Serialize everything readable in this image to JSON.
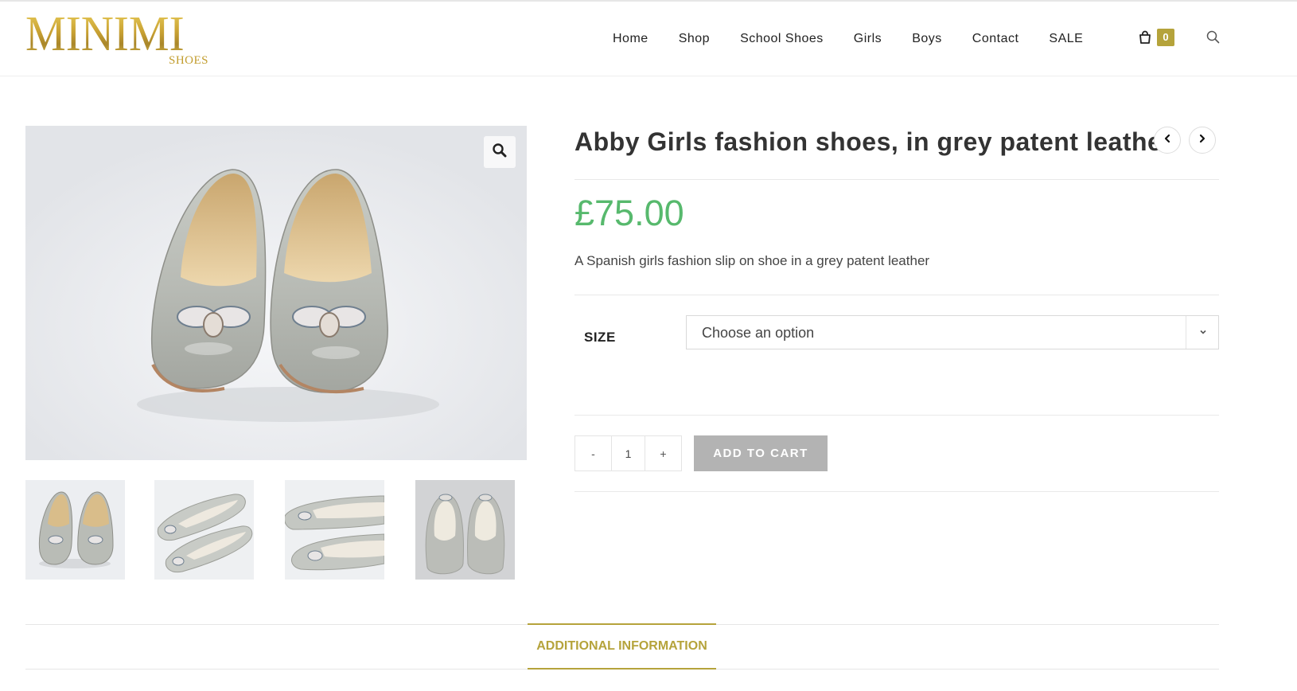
{
  "brand": {
    "logo_main": "MINIMI",
    "logo_sub": "SHOES"
  },
  "nav": {
    "items": [
      {
        "label": "Home"
      },
      {
        "label": "Shop"
      },
      {
        "label": "School Shoes"
      },
      {
        "label": "Girls"
      },
      {
        "label": "Boys"
      },
      {
        "label": "Contact"
      },
      {
        "label": "SALE"
      }
    ],
    "cart_count": "0"
  },
  "product": {
    "title": "Abby Girls fashion shoes, in grey patent leather",
    "price": "£75.00",
    "description": "A Spanish girls fashion slip on shoe in a grey patent leather",
    "size_label": "SIZE",
    "size_select": "Choose an option",
    "quantity": "1",
    "qty_minus": "-",
    "qty_plus": "+",
    "add_to_cart": "ADD TO CART",
    "price_color": "#57b96d",
    "accent_color": "#b5a33b"
  },
  "gallery": {
    "main_image": "grey patent ballet flats with jeweled bows, front view",
    "thumbnails": [
      "front view",
      "side view angled",
      "side view pair",
      "top view"
    ]
  },
  "tabs": [
    {
      "label": "ADDITIONAL INFORMATION"
    }
  ]
}
